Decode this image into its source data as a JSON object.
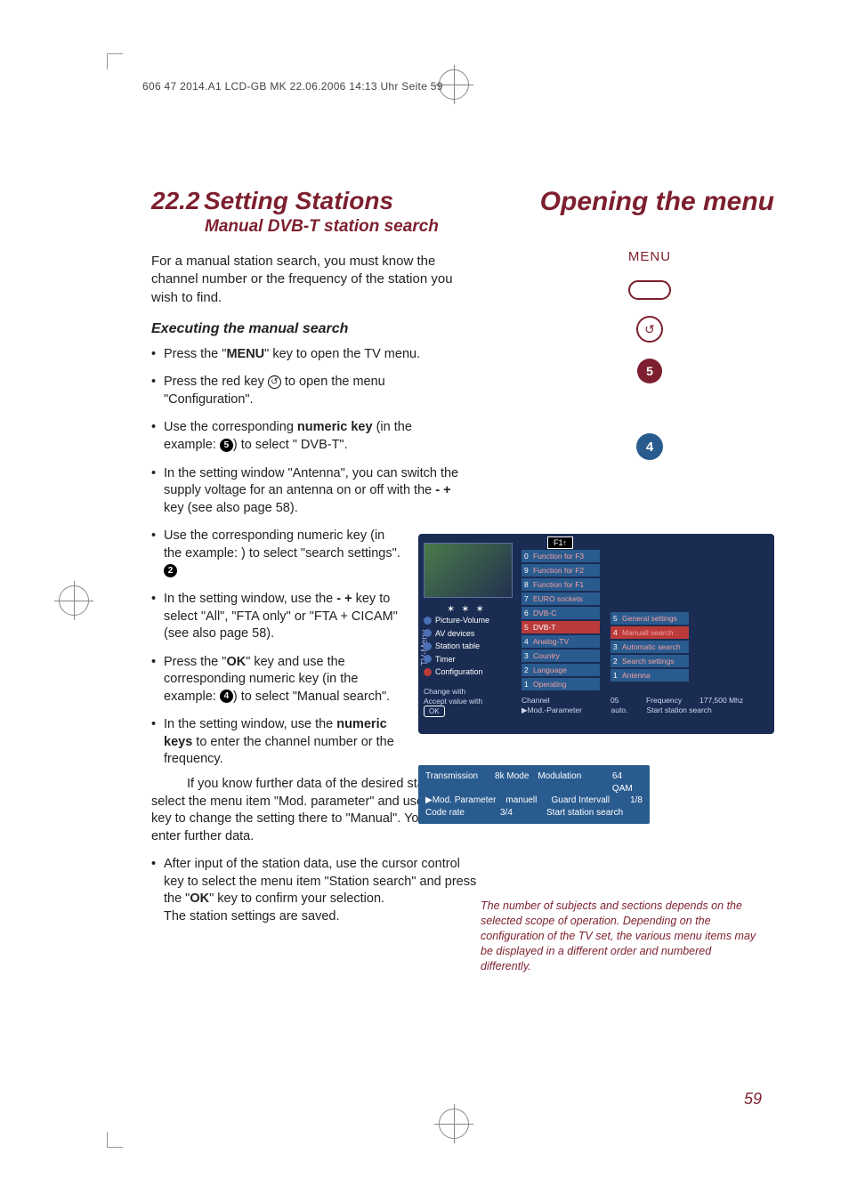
{
  "header_line": "606 47 2014.A1 LCD-GB MK  22.06.2006  14:13 Uhr  Seite 59",
  "section": {
    "number": "22.2",
    "title": "Setting Stations",
    "subtitle": "Manual DVB-T station search",
    "opening": "Opening the menu"
  },
  "intro": "For a manual station search, you must know the channel number or the frequency of the station you wish to find.",
  "h3": "Executing the manual search",
  "steps1": [
    {
      "pre": "Press the \"",
      "b": "MENU",
      "post": "\" key to open the TV menu."
    },
    {
      "pre": "Press the red key ",
      "icon": "↺",
      "post": " to open the menu \"Configuration\"."
    },
    {
      "pre": "Use the corresponding ",
      "b": "numeric key",
      "post": " (in the example: ",
      "num": "5",
      "tail": ") to select \" DVB-T\"."
    },
    {
      "pre": "In the setting window \"Antenna\", you can switch the supply voltage for an antenna on or off with the ",
      "b": "- +",
      "post": " key  (see also page 58)."
    }
  ],
  "steps2": [
    {
      "pre": "Use the corresponding numeric key (in the example: ",
      "num": "2",
      "post": ") to select \"search settings\"."
    },
    {
      "pre": "In the setting window, use the ",
      "b": "- +",
      "post": " key to select \"All\", \"FTA only\" or \"FTA + CICAM\" (see also page 58)."
    },
    {
      "pre": "Press the \"",
      "b": "OK",
      "post": "\" key and use the corresponding numeric key (in the example: ",
      "num": "4",
      "tail": ") to select \"Manual search\"."
    },
    {
      "pre": "In the setting window, use the ",
      "b": "numeric keys",
      "post": " to enter the channel number or the frequency."
    }
  ],
  "para": "If you know further data of the desired station, select the menu item \"Mod. parameter\" and use the - + key to change the setting there to \"Manual\". You can then enter further data.",
  "final_prefix": "After input of the station data, use the cursor control key to select the menu item \"Station search\" and press the \"",
  "final_bold": "OK",
  "final_suffix": "\" key to confirm your selection.",
  "final_line2": "The station settings are saved.",
  "remote": {
    "menu_label": "MENU",
    "red_glyph": "↺",
    "remote_num": "5",
    "blue_num": "4"
  },
  "osd": {
    "f1": "F1↑",
    "tv_menu": "TV-Menu",
    "stars": "✶ ✶ ✶",
    "sidebar": [
      "Picture-Volume",
      "AV devices",
      "Station table",
      "Timer",
      "Configuration"
    ],
    "hint_line1": "Change with",
    "hint_line2": "Accept value with",
    "ok": "OK",
    "col1": [
      {
        "n": "0",
        "t": "Function for F3"
      },
      {
        "n": "9",
        "t": "Function for F2"
      },
      {
        "n": "8",
        "t": "Function for F1"
      },
      {
        "n": "7",
        "t": "EURO sockets"
      },
      {
        "n": "6",
        "t": "DVB-C"
      },
      {
        "n": "5",
        "t": "DVB-T",
        "sel": true
      },
      {
        "n": "4",
        "t": "Analog-TV"
      },
      {
        "n": "3",
        "t": "Country"
      },
      {
        "n": "2",
        "t": "Language"
      },
      {
        "n": "1",
        "t": "Operating"
      }
    ],
    "col2": [
      {
        "n": "5",
        "t": "General settings"
      },
      {
        "n": "4",
        "t": "Manuall search",
        "sel": true
      },
      {
        "n": "3",
        "t": "Automatic search"
      },
      {
        "n": "2",
        "t": "Search settings"
      },
      {
        "n": "1",
        "t": "Antenna"
      }
    ],
    "bottom": {
      "channel_l": "Channel",
      "channel_v": "05",
      "freq_l": "Frequency",
      "freq_v": "177,500 Mhz",
      "mod_l": "Mod.-Parameter",
      "mod_v": "auto.",
      "start": "Start station search"
    }
  },
  "params": {
    "rows": [
      {
        "l": "Transmission",
        "v": "8k Mode",
        "l2": "Modulation",
        "v2": "64 QAM"
      },
      {
        "l": "Mod. Parameter",
        "v": "manuell",
        "l2": "Guard Intervall",
        "v2": "1/8"
      },
      {
        "l": "Code rate",
        "v": "3/4",
        "l2": "Start station search",
        "v2": ""
      }
    ]
  },
  "footnote": "The number of subjects and sections depends on the selected scope of operation. Depending on the configuration of the TV set, the various menu items may be displayed in a different order and numbered differently.",
  "page_number": "59"
}
